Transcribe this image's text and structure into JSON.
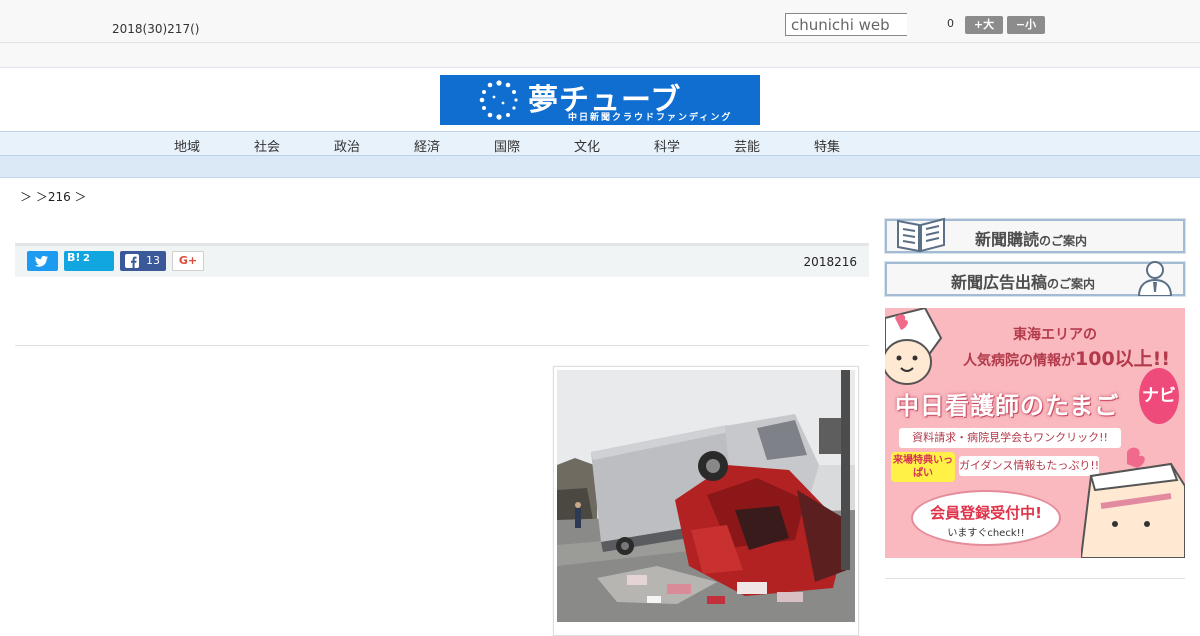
{
  "topbar": {
    "date": "2018(30)217()",
    "search_placeholder": "chunichi web",
    "counter": "0",
    "font_larger_label": "+大",
    "font_smaller_label": "−小"
  },
  "logo": {
    "main": "夢チューブ",
    "sub": "中日新聞クラウドファンディング"
  },
  "nav": {
    "items": [
      "地域",
      "社会",
      "政治",
      "経済",
      "国際",
      "文化",
      "科学",
      "芸能",
      "特集"
    ]
  },
  "breadcrumb": "＞ ＞216 ＞",
  "share": {
    "hatena_mark": "B!",
    "hatena_count": "2",
    "facebook_count": "13",
    "gplus_label": "G+",
    "date": "2018216"
  },
  "sidebar": {
    "banner1_main": "新聞購読",
    "banner1_sub": "のご案内",
    "banner2_main": "新聞広告出稿",
    "banner2_sub": "のご案内"
  },
  "ad": {
    "line1": "東海エリアの",
    "line2a": "人気病院の情報が",
    "line2b": "100以上!!",
    "title": "中日看護師のたまご",
    "navi": "ナビ",
    "bullet1": "資料請求・病院見学会もワンクリック!!",
    "tag": "来場特典いっぱい",
    "bullet2": "ガイダンス情報もたっぷり!!",
    "cta": "会員登録受付中!",
    "cta_sub": "いますぐcheck!!"
  },
  "colors": {
    "brand_blue": "#0f6ed0",
    "nav_bg": "#e8f2fb",
    "twitter": "#1d9bf0",
    "hatena": "#12a6e0",
    "facebook": "#3b5998",
    "ad_pink": "#f9b9bf"
  }
}
